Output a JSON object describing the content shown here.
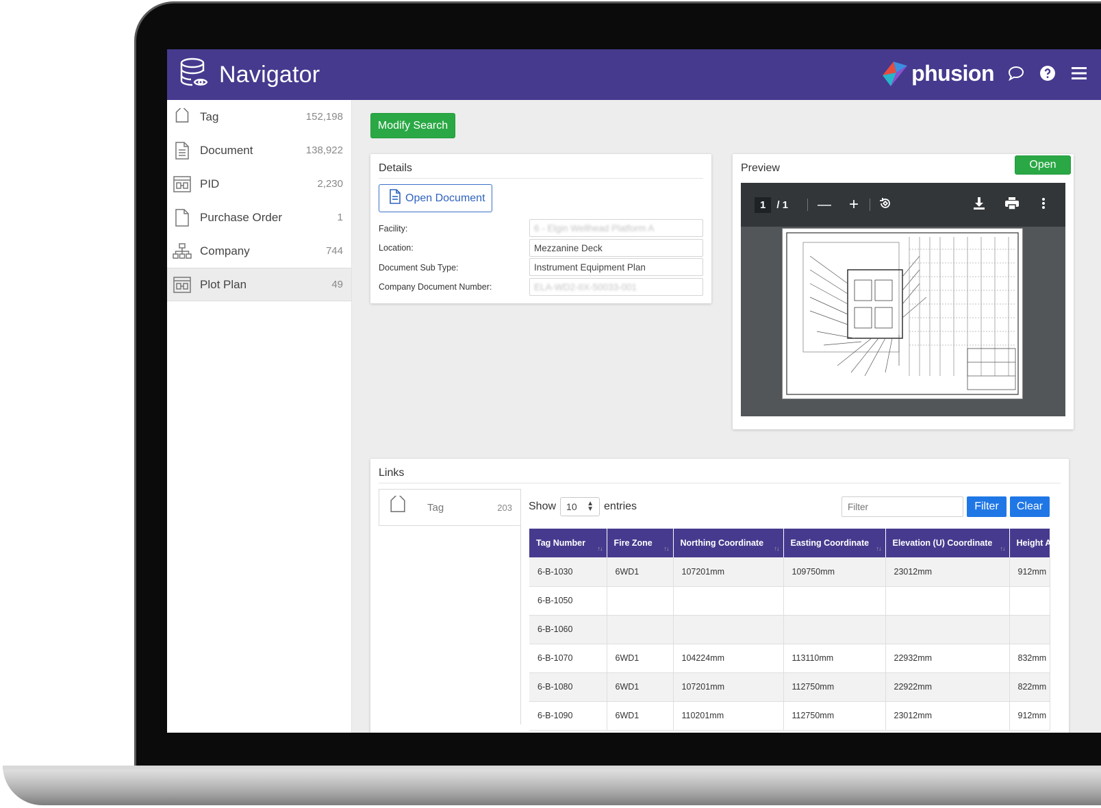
{
  "header": {
    "title": "Navigator",
    "brand": "phusion"
  },
  "sidebar": {
    "items": [
      {
        "label": "Tag",
        "count": "152,198",
        "icon": "tag-icon"
      },
      {
        "label": "Document",
        "count": "138,922",
        "icon": "document-icon"
      },
      {
        "label": "PID",
        "count": "2,230",
        "icon": "pid-icon"
      },
      {
        "label": "Purchase Order",
        "count": "1",
        "icon": "purchase-order-icon"
      },
      {
        "label": "Company",
        "count": "744",
        "icon": "company-icon"
      },
      {
        "label": "Plot Plan",
        "count": "49",
        "icon": "plot-plan-icon"
      }
    ]
  },
  "main": {
    "modify_search": "Modify Search",
    "details": {
      "title": "Details",
      "open_document": "Open Document",
      "fields": [
        {
          "label": "Facility:",
          "value": "6 - Elgin Wellhead Platform A",
          "blurred": true
        },
        {
          "label": "Location:",
          "value": "Mezzanine Deck",
          "blurred": false
        },
        {
          "label": "Document Sub Type:",
          "value": "Instrument Equipment Plan",
          "blurred": false
        },
        {
          "label": "Company Document Number:",
          "value": "ELA-WD2-IIX-50033-001",
          "blurred": true
        }
      ]
    },
    "preview": {
      "title": "Preview",
      "open": "Open",
      "page_current": "1",
      "page_total": "/ 1"
    },
    "links": {
      "title": "Links",
      "left_item": {
        "label": "Tag",
        "count": "203"
      },
      "show": "Show",
      "entries_value": "10",
      "entries": "entries",
      "filter_placeholder": "Filter",
      "filter_btn": "Filter",
      "clear_btn": "Clear",
      "columns": [
        "Tag Number",
        "Fire Zone",
        "Northing Coordinate",
        "Easting Coordinate",
        "Elevation (U) Coordinate",
        "Height A"
      ],
      "rows": [
        [
          "6-B-1030",
          "6WD1",
          "107201mm",
          "109750mm",
          "23012mm",
          "912mm"
        ],
        [
          "6-B-1050",
          "",
          "",
          "",
          "",
          ""
        ],
        [
          "6-B-1060",
          "",
          "",
          "",
          "",
          ""
        ],
        [
          "6-B-1070",
          "6WD1",
          "104224mm",
          "113110mm",
          "22932mm",
          "832mm"
        ],
        [
          "6-B-1080",
          "6WD1",
          "107201mm",
          "112750mm",
          "22922mm",
          "822mm"
        ],
        [
          "6-B-1090",
          "6WD1",
          "110201mm",
          "112750mm",
          "23012mm",
          "912mm"
        ]
      ]
    }
  },
  "colors": {
    "header": "#463a8e",
    "green": "#2aa845",
    "blue": "#1f77e6"
  }
}
